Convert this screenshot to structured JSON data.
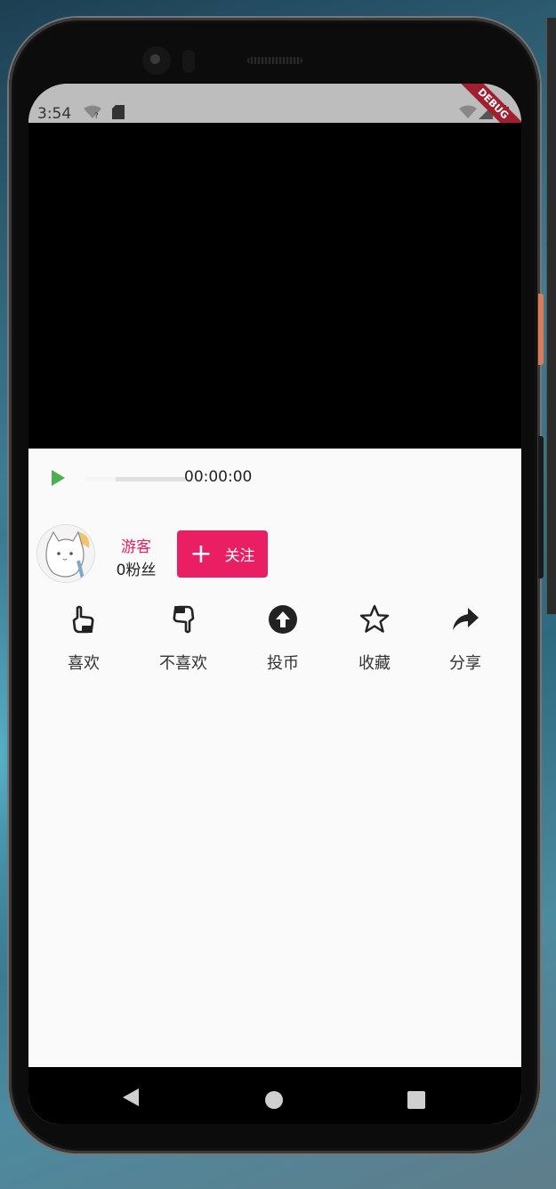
{
  "status_bar": {
    "time": "3:54"
  },
  "debug_banner": "DEBUG",
  "player": {
    "time": "00:00:00",
    "progress": 0.0
  },
  "author": {
    "name": "游客",
    "fans": "0粉丝",
    "follow_label": "关注"
  },
  "actions": [
    {
      "label": "喜欢",
      "icon": "thumb-up-icon"
    },
    {
      "label": "不喜欢",
      "icon": "thumb-down-icon"
    },
    {
      "label": "投币",
      "icon": "arrow-up-circle-icon"
    },
    {
      "label": "收藏",
      "icon": "star-icon"
    },
    {
      "label": "分享",
      "icon": "share-icon"
    }
  ],
  "colors": {
    "accent": "#e91e63",
    "play": "#4caf50",
    "status_bar": "#bdbdbd",
    "debug": "#a02030"
  }
}
